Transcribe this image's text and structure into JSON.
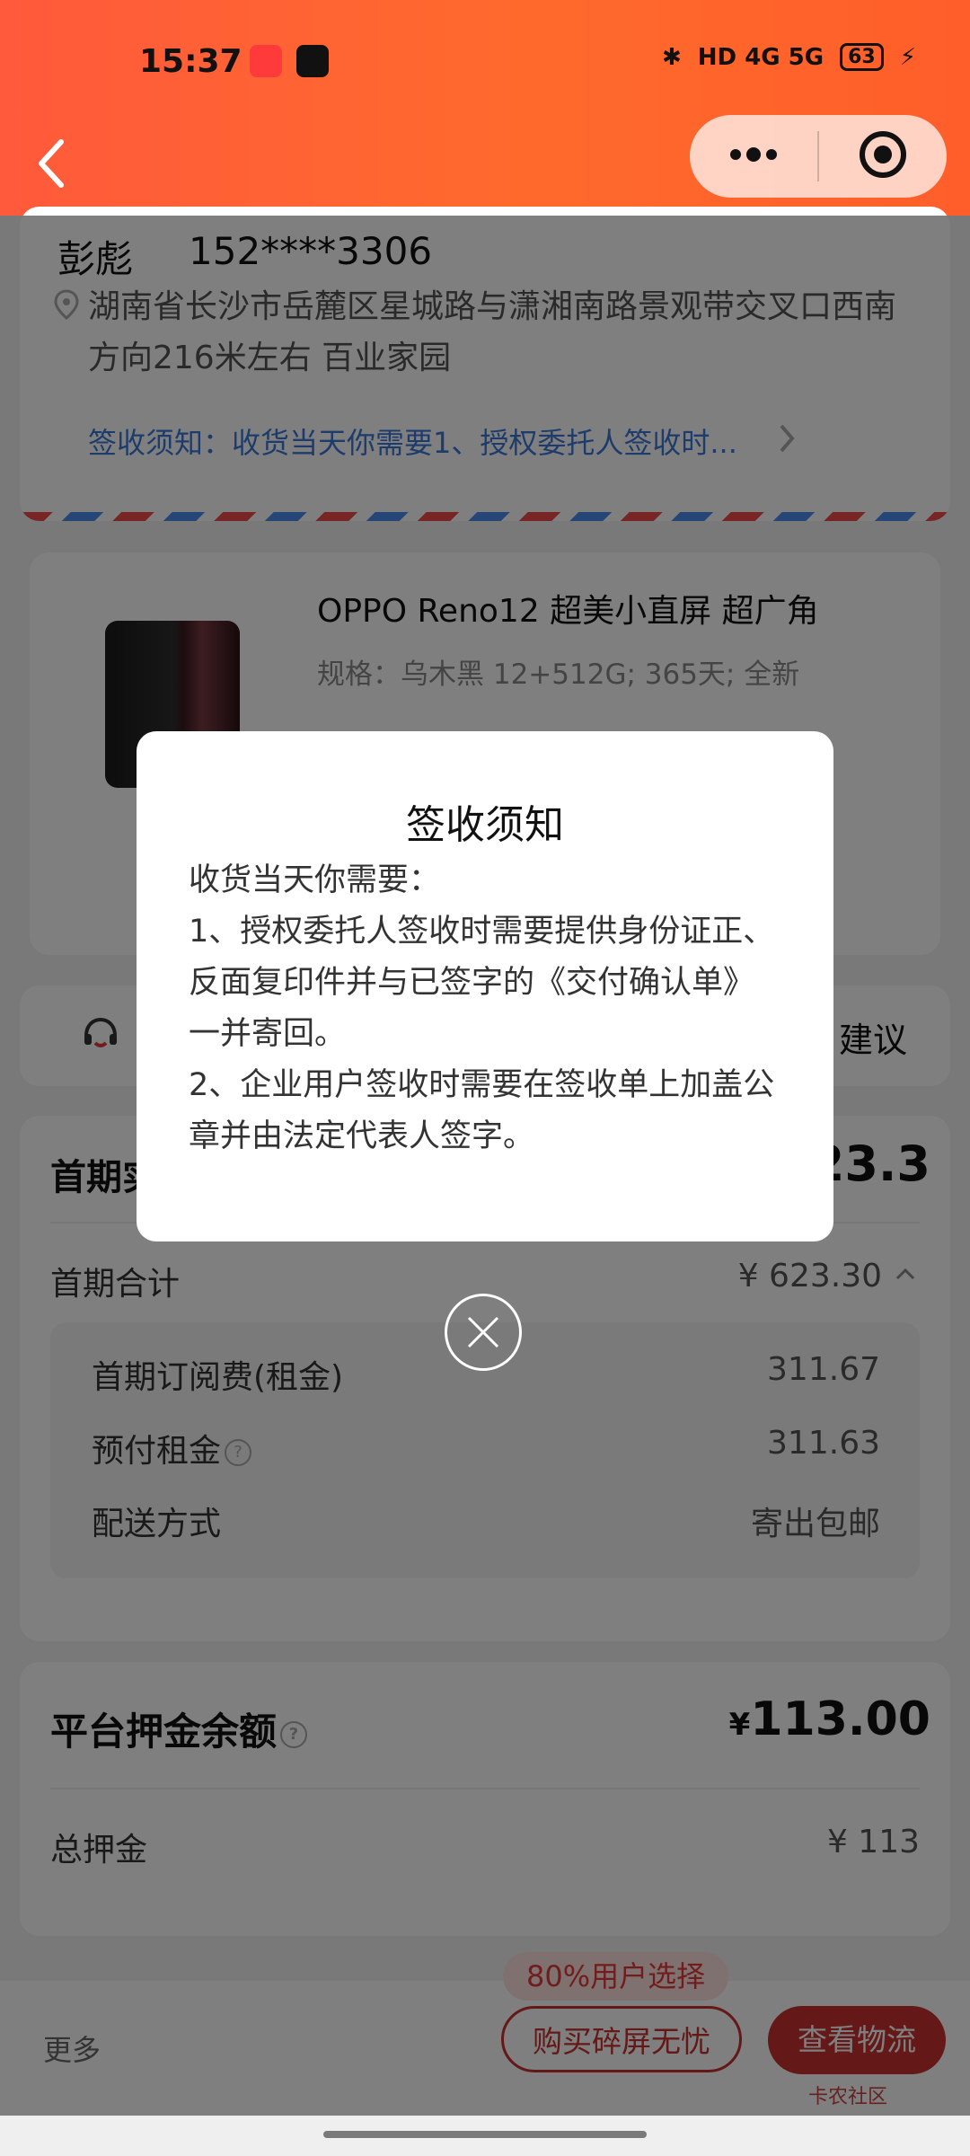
{
  "status_bar": {
    "time": "15:37",
    "network": "HD 4G 5G",
    "battery": "63"
  },
  "address": {
    "name": "彭彪",
    "phone": "152****3306",
    "address": "湖南省长沙市岳麓区星城路与潇湘南路景观带交叉口西南方向216米左右 百业家园",
    "notice_summary": "签收须知：收货当天你需要1、授权委托人签收时..."
  },
  "product": {
    "title": "OPPO Reno12 超美小直屏 超广角",
    "spec": "规格：乌木黑 12+512G; 365天; 全新"
  },
  "service": {
    "right_label": "建议"
  },
  "summary": {
    "first_pay_label": "首期实",
    "first_pay_value": "23.3",
    "first_total_label": "首期合计",
    "first_total_value": "¥ 623.30",
    "items": [
      {
        "label": "首期订阅费(租金)",
        "value": "311.67"
      },
      {
        "label": "预付租金",
        "value": "311.63"
      },
      {
        "label": "配送方式",
        "value": "寄出包邮"
      }
    ]
  },
  "deposit": {
    "balance_label": "平台押金余额",
    "balance_value": "113.00",
    "currency": "¥",
    "total_label": "总押金",
    "total_value": "¥ 113"
  },
  "bottom_bar": {
    "more": "更多",
    "badge": "80%用户选择",
    "buy_label": "购买碎屏无忧",
    "logistics_label": "查看物流",
    "watermark": "卡农社区"
  },
  "modal": {
    "title": "签收须知",
    "body": "收货当天你需要：\n1、授权委托人签收时需要提供身份证正、反面复印件并与已签字的《交付确认单》一并寄回。\n2、企业用户签收时需要在签收单上加盖公章并由法定代表人签字。"
  },
  "colors": {
    "header": "#ff5a3c",
    "accent": "#c8302e",
    "link": "#3a78d8"
  }
}
